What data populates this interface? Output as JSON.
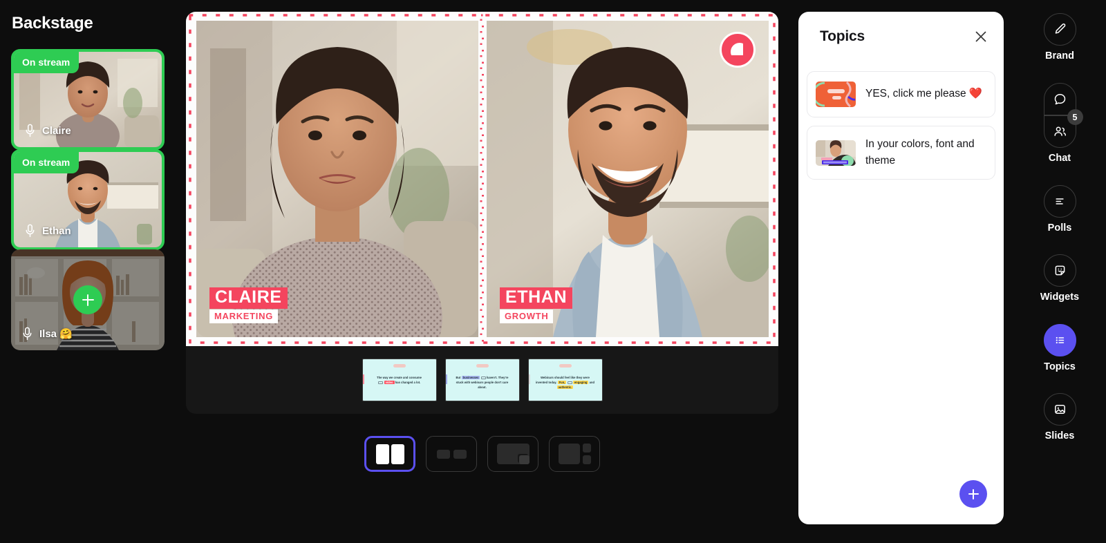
{
  "sidebar": {
    "title": "Backstage",
    "participants": [
      {
        "name": "Claire",
        "status": "On stream",
        "on_stream": true,
        "mic_icon": "microphone-icon"
      },
      {
        "name": "Ethan",
        "status": "On stream",
        "on_stream": true,
        "mic_icon": "microphone-icon"
      },
      {
        "name": "Ilsa 🤗",
        "status": "",
        "on_stream": false,
        "mic_icon": "microphone-icon",
        "add_label": "+"
      }
    ]
  },
  "stage": {
    "tiles": [
      {
        "speaker_name": "CLAIRE",
        "speaker_role": "MARKETING"
      },
      {
        "speaker_name": "ETHAN",
        "speaker_role": "GROWTH"
      }
    ],
    "brand_logo": "brand-logo-icon",
    "slides": [
      {
        "index": 1,
        "text_parts": [
          {
            "t": "The way we create and consume",
            "hl": "none"
          },
          {
            "t": "video",
            "hl": "red"
          },
          {
            "t": "has changed a lot.",
            "hl": "none"
          }
        ]
      },
      {
        "index": 2,
        "text_parts": [
          {
            "t": "But",
            "hl": "none"
          },
          {
            "t": "businesses",
            "hl": "blue"
          },
          {
            "t": "haven't. They're stuck with webinars people don't care about.",
            "hl": "none"
          }
        ]
      },
      {
        "index": 3,
        "text_parts": [
          {
            "t": "Webinars should feel like they were invented today. Fun,",
            "hl": "none"
          },
          {
            "t": "engaging",
            "hl": "yellow"
          },
          {
            "t": "and",
            "hl": "none"
          },
          {
            "t": "authentic.",
            "hl": "yellow"
          }
        ]
      }
    ]
  },
  "layouts": [
    {
      "id": "split-two",
      "name": "two-column-layout",
      "selected": true
    },
    {
      "id": "two-small",
      "name": "two-small-tiles-layout",
      "selected": false
    },
    {
      "id": "pip-bottom",
      "name": "picture-in-picture-layout",
      "selected": false
    },
    {
      "id": "main-sidebar",
      "name": "main-with-sidebar-layout",
      "selected": false
    }
  ],
  "topics": {
    "title": "Topics",
    "close_icon": "close-icon",
    "add_icon": "plus-icon",
    "items": [
      {
        "label": "YES, click me please ❤️",
        "thumb": "orange-card-thumbnail"
      },
      {
        "label": "In your colors, font and theme",
        "thumb": "video-preview-thumbnail"
      }
    ]
  },
  "rail": {
    "items": [
      {
        "label": "Brand",
        "icon": "pencil-icon",
        "active": false,
        "badge": null
      },
      {
        "label": "Chat",
        "icon": "chat-bubble-icon",
        "secondary_icon": "people-icon",
        "active": false,
        "badge": "5"
      },
      {
        "label": "Polls",
        "icon": "poll-bars-icon",
        "active": false,
        "badge": null
      },
      {
        "label": "Widgets",
        "icon": "sticker-icon",
        "active": false,
        "badge": null
      },
      {
        "label": "Topics",
        "icon": "list-icon",
        "active": true,
        "badge": null
      },
      {
        "label": "Slides",
        "icon": "image-icon",
        "active": false,
        "badge": null
      }
    ]
  },
  "colors": {
    "accent_purple": "#5b50f0",
    "on_stream_green": "#2ecc53",
    "brand_pink": "#f4455e",
    "slide_bg": "#d6f7f5",
    "app_bg": "#0d0d0d"
  }
}
